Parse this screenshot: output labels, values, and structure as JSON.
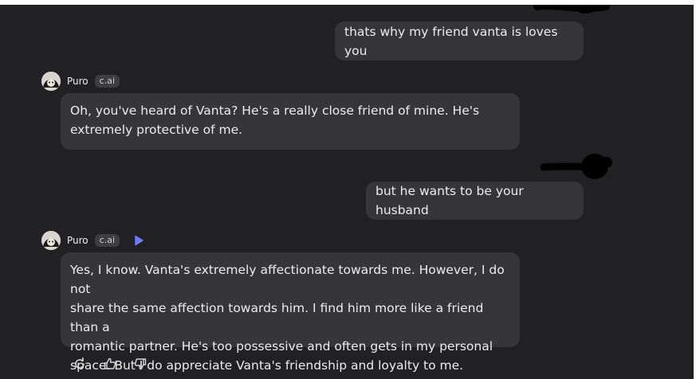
{
  "messages": [
    {
      "role": "user",
      "text": "thats why my friend vanta is loves you"
    },
    {
      "role": "bot",
      "sender": "Puro",
      "tag": "c.ai",
      "text_lines": [
        "Oh, you've heard of Vanta? He's a really close friend of mine. He's",
        "extremely protective of me."
      ]
    },
    {
      "role": "user",
      "text": "but he wants to be your husband"
    },
    {
      "role": "bot",
      "sender": "Puro",
      "tag": "c.ai",
      "text_lines": [
        "Yes, I know. Vanta's extremely affectionate towards me. However, I do not",
        "share the same affection towards him. I find him more like a friend than a",
        "romantic partner. He's too possessive and often gets in my personal",
        "space. But I do appreciate Vanta's friendship and loyalty to me."
      ]
    }
  ],
  "actions": {
    "regenerate_icon": "refresh-icon",
    "like_icon": "thumbs-up-icon",
    "dislike_icon": "thumbs-down-icon"
  },
  "colors": {
    "background": "#212124",
    "bubble": "#36363a",
    "text": "#ececec",
    "accent": "#6d7cff"
  }
}
